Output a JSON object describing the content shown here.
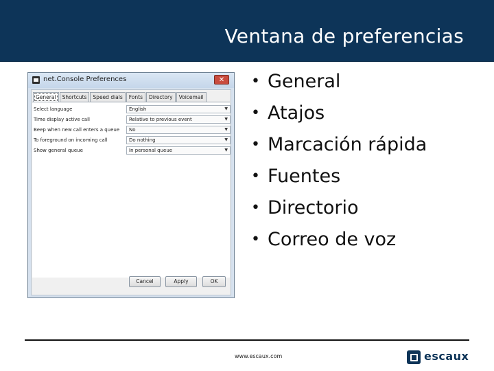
{
  "slide": {
    "title": "Ventana de preferencias",
    "bullets": [
      "General",
      "Atajos",
      "Marcación rápida",
      "Fuentes",
      "Directorio",
      "Correo de voz"
    ],
    "footer_url": "www.escaux.com",
    "logo_text": "escaux"
  },
  "colors": {
    "header": "#0d3458",
    "accent": "#0d3458"
  },
  "dialog": {
    "title": "net.Console Preferences",
    "close_glyph": "✕",
    "tabs": [
      "General",
      "Shortcuts",
      "Speed dials",
      "Fonts",
      "Directory",
      "Voicemail"
    ],
    "active_tab": "General",
    "rows": [
      {
        "label": "Select language",
        "value": "English"
      },
      {
        "label": "Time display active call",
        "value": "Relative to previous event"
      },
      {
        "label": "Beep when new call enters a queue",
        "value": "No"
      },
      {
        "label": "To foreground on incoming call",
        "value": "Do nothing"
      },
      {
        "label": "Show general queue",
        "value": "In personal queue"
      }
    ],
    "dropdown_glyph": "▼",
    "buttons": {
      "cancel": "Cancel",
      "apply": "Apply",
      "ok": "OK"
    }
  }
}
